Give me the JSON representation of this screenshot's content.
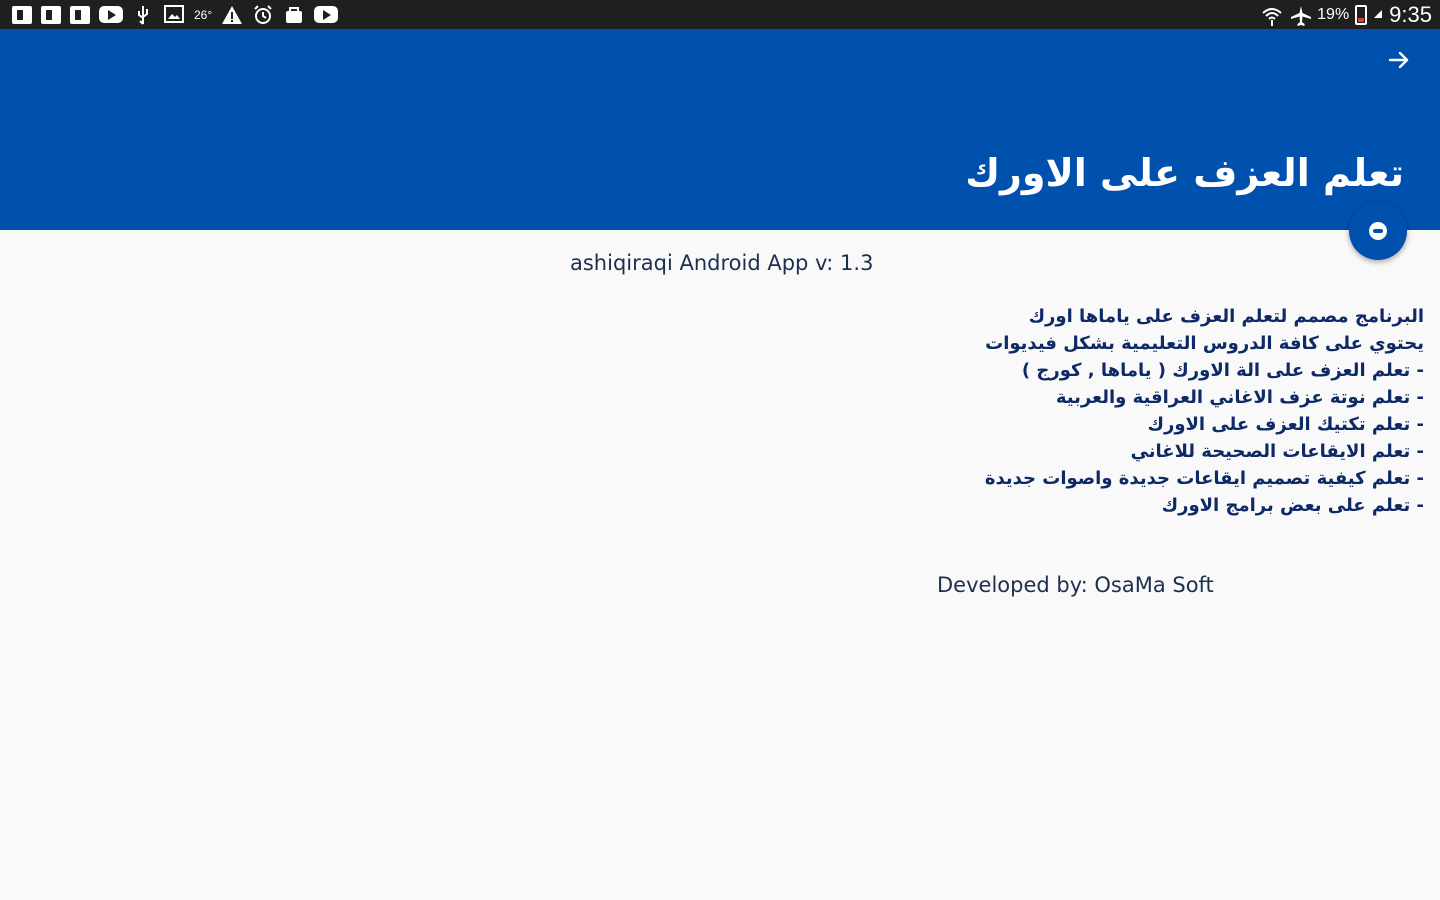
{
  "status_bar": {
    "temperature": "26°",
    "battery": "19%",
    "time": "9:35",
    "left_icons": [
      "facebook-icon",
      "facebook-icon",
      "facebook-icon",
      "youtube-icon",
      "usb-icon",
      "gallery-icon",
      "weather-icon",
      "warning-icon",
      "alarm-icon",
      "store-icon",
      "youtube-icon"
    ],
    "right_icons": [
      "wifi-icon",
      "airplane-mode-icon",
      "battery-icon"
    ]
  },
  "app_bar": {
    "title": "تعلم العزف على الاورك",
    "back_icon": "arrow-forward-icon",
    "background_color": "#0050ad"
  },
  "fab": {
    "icon": "app-logo-icon"
  },
  "content": {
    "version": "ashiqiraqi Android App v: 1.3",
    "description_lines": [
      "البرنامج مصمم لتعلم العزف على ياماها اورك",
      "يحتوي على كافة الدروس التعليمية بشكل فيديوات",
      "- تعلم العزف على الة الاورك ( ياماها , كورج )",
      "- تعلم نوتة عزف الاغاني العراقية والعربية",
      "- تعلم تكتيك العزف على الاورك",
      "- تعلم الايقاعات الصحيحة للاغاني",
      "- تعلم كيفية تصميم ايقاعات جديدة واصوات جديدة",
      "- تعلم على بعض برامج الاورك"
    ],
    "developer": "Developed by: OsaMa Soft"
  }
}
